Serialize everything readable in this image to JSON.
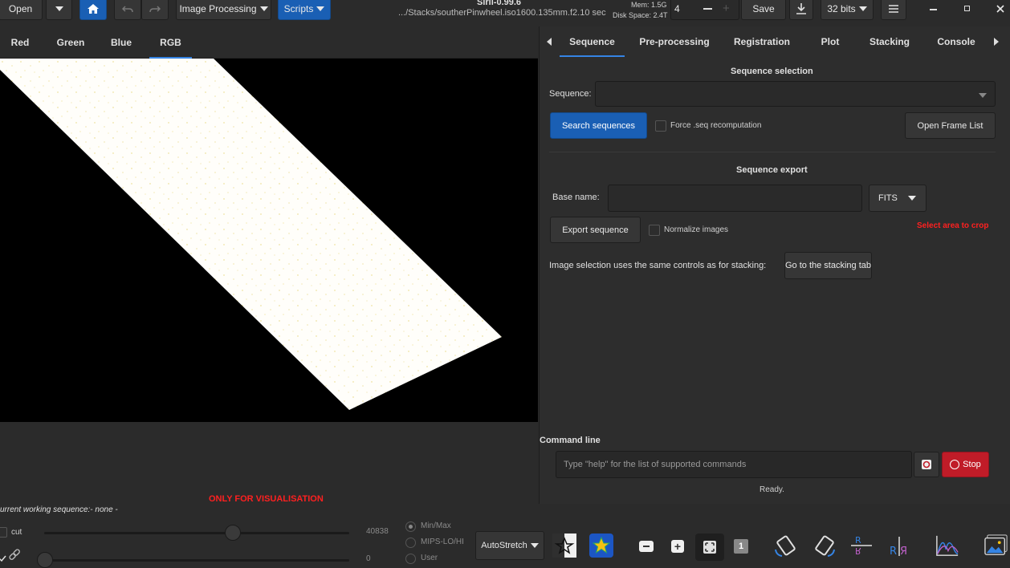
{
  "app": {
    "title": "Siril-0.99.6",
    "path": ".../Stacks/southerPinwheel.iso1600.135mm.f2.10 sec",
    "mem": "Mem: 1.5G",
    "disk": "Disk Space: 2.4T"
  },
  "toolbar": {
    "open_label": "Open",
    "image_processing_label": "Image Processing",
    "scripts_label": "Scripts",
    "thread_value": "4",
    "save_label": "Save",
    "bits_label": "32 bits"
  },
  "channel_tabs": [
    "Red",
    "Green",
    "Blue",
    "RGB"
  ],
  "right_tabs": [
    "Sequence",
    "Pre-processing",
    "Registration",
    "Plot",
    "Stacking",
    "Console"
  ],
  "sequence": {
    "selection_title": "Sequence selection",
    "sequence_label": "Sequence:",
    "sequence_value": "",
    "search_button": "Search sequences",
    "force_label": "Force .seq recomputation",
    "open_frame_list": "Open Frame List",
    "export_title": "Sequence export",
    "base_name_label": "Base name:",
    "base_name_value": "",
    "format_value": "FITS",
    "export_button": "Export sequence",
    "normalize_label": "Normalize images",
    "crop_hint": "Select area to crop",
    "stacking_hint": "Image selection uses the same controls as for stacking:",
    "goto_stacking": "Go to the stacking tab"
  },
  "command": {
    "title": "Command line",
    "placeholder": "Type \"help\" for the list of supported commands",
    "stop_label": "Stop",
    "status": "Ready."
  },
  "viewer": {
    "overlay_text": "ONLY FOR VISUALISATION"
  },
  "bottom": {
    "working_sequence": "urrent working sequence:- none -",
    "cut_label": "cut",
    "max_value": "40838",
    "min_value": "0",
    "radio_minmax": "Min/Max",
    "radio_mips": "MIPS-LO/HI",
    "radio_user": "User",
    "stretch_value": "AutoStretch"
  },
  "colors": {
    "accent": "#1a5fb4",
    "stop": "#c01c28",
    "warning_text": "#ff2020"
  }
}
